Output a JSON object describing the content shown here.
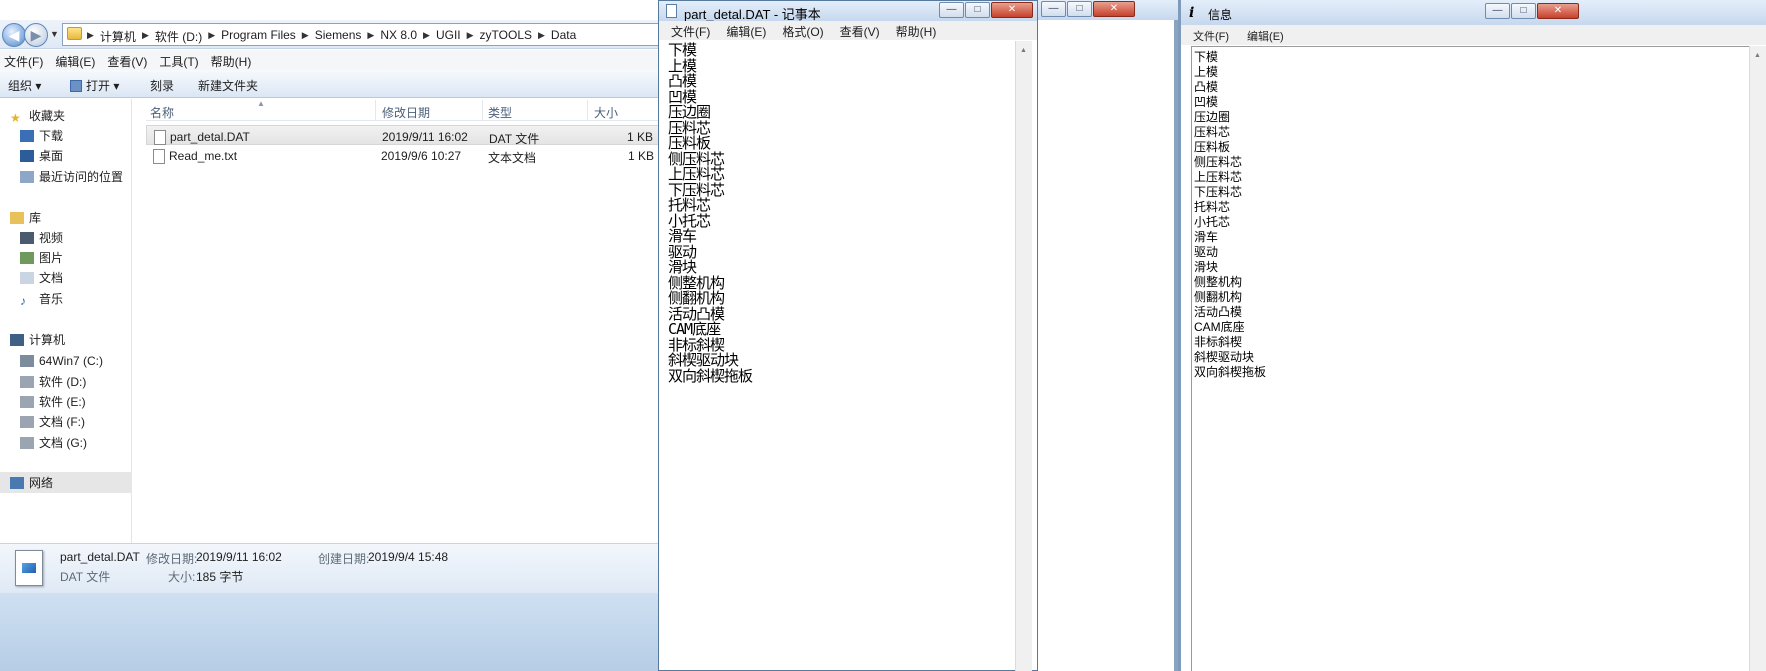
{
  "explorer": {
    "breadcrumb": [
      "计算机",
      "软件 (D:)",
      "Program Files",
      "Siemens",
      "NX 8.0",
      "UGII",
      "zyTOOLS",
      "Data"
    ],
    "menu": [
      "文件(F)",
      "编辑(E)",
      "查看(V)",
      "工具(T)",
      "帮助(H)"
    ],
    "toolbar": {
      "organize": "组织 ▾",
      "open": "打开 ▾",
      "burn": "刻录",
      "new_folder": "新建文件夹"
    },
    "nav": {
      "favorites": "收藏夹",
      "favorites_items": [
        "下载",
        "桌面",
        "最近访问的位置"
      ],
      "libraries": "库",
      "library_items": [
        "视频",
        "图片",
        "文档",
        "音乐"
      ],
      "computer": "计算机",
      "drives": [
        "64Win7   (C:)",
        "软件 (D:)",
        "软件 (E:)",
        "文档 (F:)",
        "文档 (G:)"
      ],
      "network": "网络"
    },
    "columns": {
      "name": "名称",
      "modified": "修改日期",
      "type": "类型",
      "size": "大小"
    },
    "files": [
      {
        "name": "part_detal.DAT",
        "modified": "2019/9/11 16:02",
        "type": "DAT 文件",
        "size": "1 KB"
      },
      {
        "name": "Read_me.txt",
        "modified": "2019/9/6 10:27",
        "type": "文本文档",
        "size": "1 KB"
      }
    ],
    "details": {
      "filename": "part_detal.DAT",
      "modified_label": "修改日期:",
      "modified_value": "2019/9/11 16:02",
      "created_label": "创建日期:",
      "created_value": "2019/9/4 15:48",
      "type": "DAT 文件",
      "size_label": "大小:",
      "size_value": "185 字节"
    }
  },
  "notepad": {
    "title": "part_detal.DAT - 记事本",
    "menu": [
      "文件(F)",
      "编辑(E)",
      "格式(O)",
      "查看(V)",
      "帮助(H)"
    ],
    "lines": [
      "下模",
      "上模",
      "凸模",
      "凹模",
      "压边圈",
      "压料芯",
      "压料板",
      "侧压料芯",
      "上压料芯",
      "下压料芯",
      "托料芯",
      "小托芯",
      "滑车",
      "驱动",
      "滑块",
      "侧整机构",
      "侧翻机构",
      "活动凸模",
      "CAM底座",
      "非标斜楔",
      "斜楔驱动块",
      "双向斜楔拖板"
    ]
  },
  "info": {
    "title": "信息",
    "icon_glyph": "i",
    "menu": [
      "文件(F)",
      "编辑(E)"
    ],
    "lines": [
      "下模",
      "上模",
      "凸模",
      "凹模",
      "压边圈",
      "压料芯",
      "压料板",
      "侧压料芯",
      "上压料芯",
      "下压料芯",
      "托料芯",
      "小托芯",
      "滑车",
      "驱动",
      "滑块",
      "侧整机构",
      "侧翻机构",
      "活动凸模",
      "CAM底座",
      "非标斜楔",
      "斜楔驱动块",
      "双向斜楔拖板"
    ]
  },
  "window_buttons": {
    "minimize": "—",
    "maximize": "□",
    "close": "✕"
  }
}
